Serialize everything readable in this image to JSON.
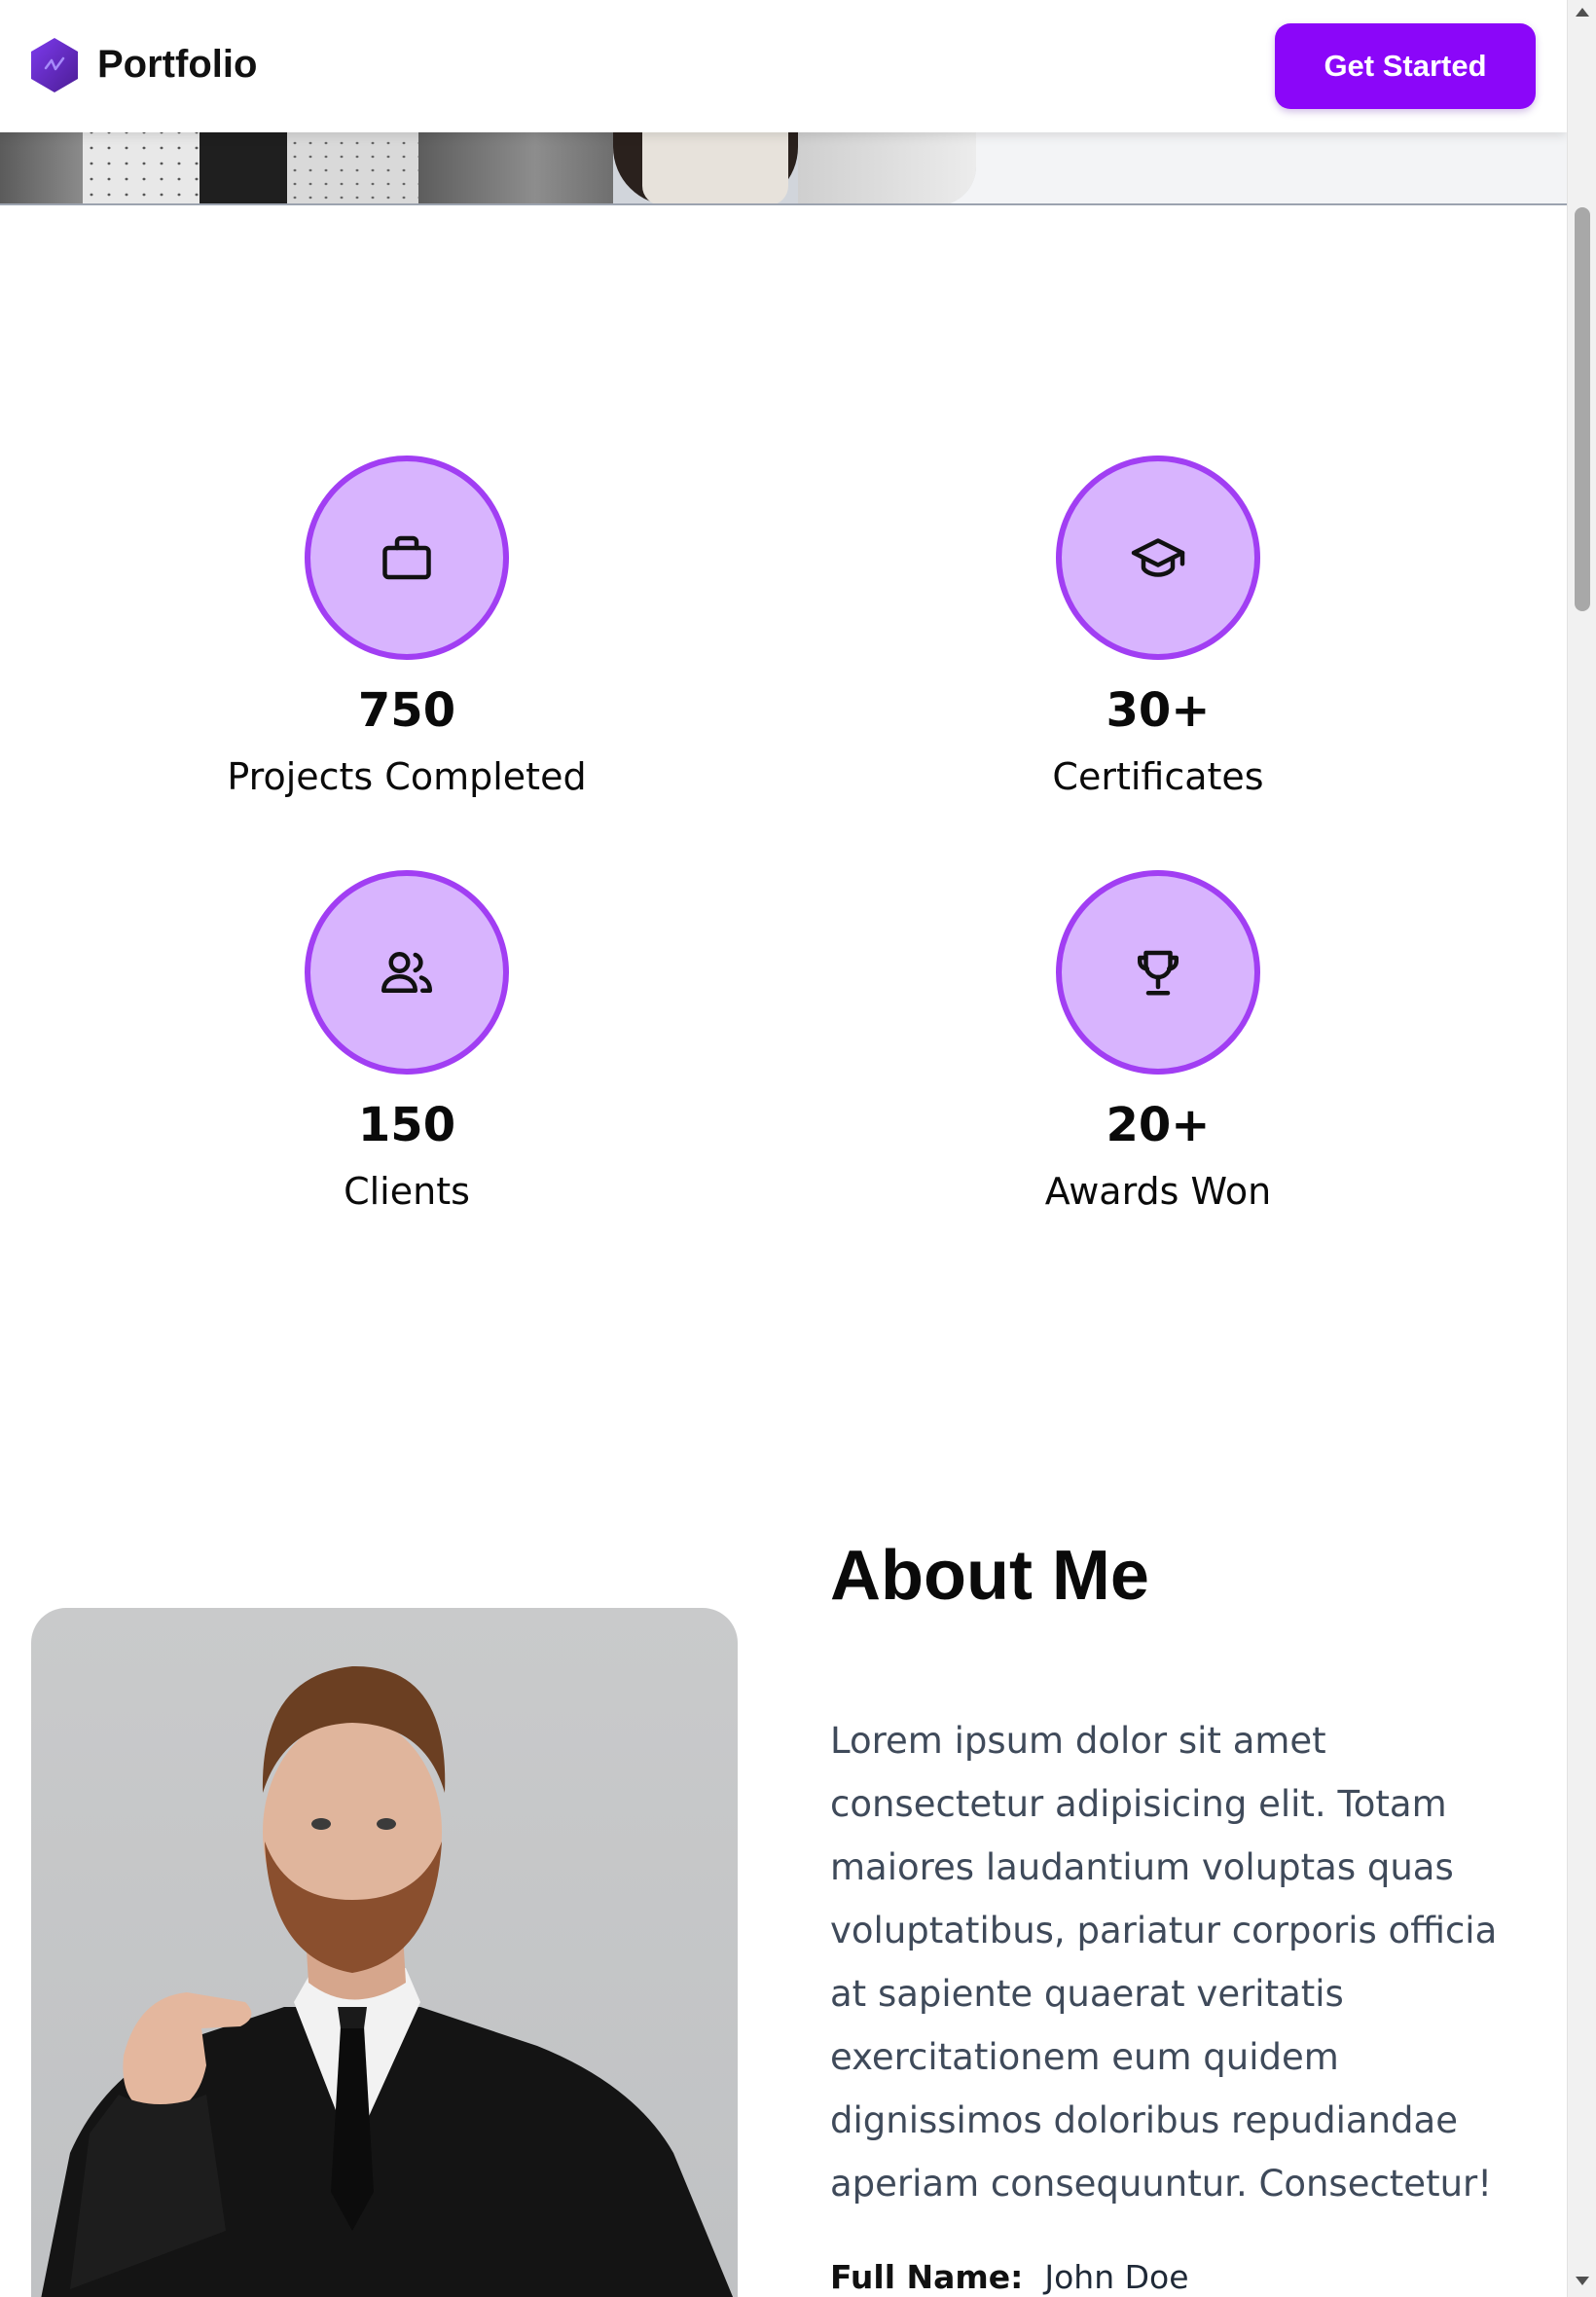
{
  "header": {
    "brand": "Portfolio",
    "cta_label": "Get Started",
    "logo_icon": "hexagon-logo-icon"
  },
  "colors": {
    "accent": "#8b06f9",
    "circle_fill": "#d8b4fe",
    "circle_border": "#a13ef3",
    "body_text": "#3f4a5a"
  },
  "stats": [
    {
      "value": "750",
      "label": "Projects Completed",
      "icon": "briefcase-icon"
    },
    {
      "value": "30+",
      "label": "Certificates",
      "icon": "graduation-cap-icon"
    },
    {
      "value": "150",
      "label": "Clients",
      "icon": "users-icon"
    },
    {
      "value": "20+",
      "label": "Awards Won",
      "icon": "trophy-icon"
    }
  ],
  "about": {
    "title": "About Me",
    "paragraph": "Lorem ipsum dolor sit amet consectetur adipisicing elit. Totam maiores laudantium voluptas quas voluptatibus, pariatur corporis officia at sapiente quaerat veritatis exercitationem eum quidem dignissimos doloribus repudiandae aperiam consequuntur. Consectetur!",
    "info": [
      {
        "key": "Full Name:",
        "value": "John Doe"
      }
    ]
  }
}
